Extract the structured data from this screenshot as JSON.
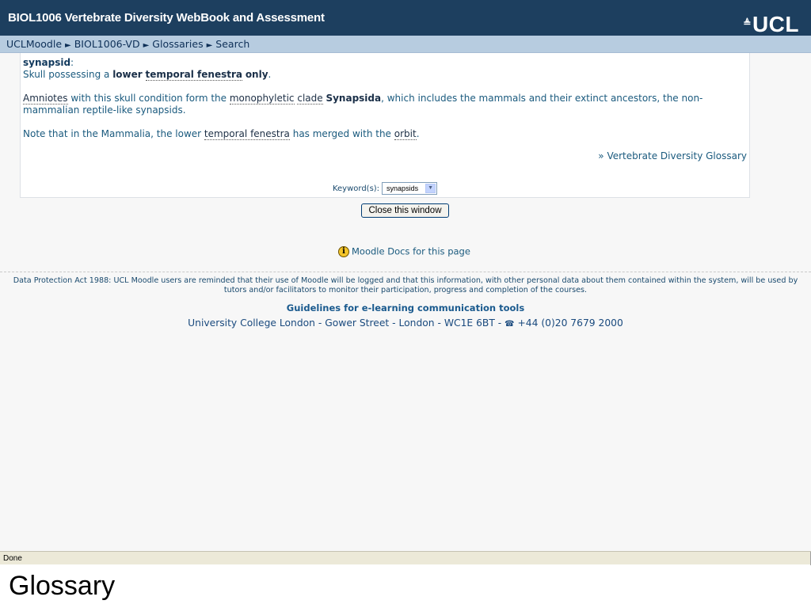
{
  "header": {
    "title": "BIOL1006 Vertebrate Diversity WebBook and Assessment",
    "logo_mark": "≜",
    "logo_text": "UCL"
  },
  "breadcrumb": {
    "items": [
      "UCLMoodle",
      "BIOL1006-VD",
      "Glossaries",
      "Search"
    ],
    "separator": "►"
  },
  "entry": {
    "concept": "synapsid",
    "colon": ":",
    "line1_prefix": "Skull possessing a ",
    "line1_bold1": "lower",
    "line1_link": "temporal fenestra",
    "line1_bold2": "only",
    "line1_end": ".",
    "p2_link1": "Amniotes",
    "p2_text1": " with this skull condition form the ",
    "p2_link2": "monophyletic",
    "p2_link3": "clade",
    "p2_bold": "Synapsida",
    "p2_text2": ", which includes the mammals and their extinct ancestors, the non-mammalian reptile-like synapsids.",
    "p3_text1": "Note that in the Mammalia, the lower ",
    "p3_link1": "temporal fenestra",
    "p3_text2": " has merged with the ",
    "p3_link2": "orbit",
    "p3_end": "."
  },
  "glossary_link": "» Vertebrate Diversity Glossary",
  "keyword": {
    "label": "Keyword(s):",
    "selected": "synapsids"
  },
  "close_button": "Close this window",
  "docs_link": "Moodle Docs for this page",
  "footer": {
    "data_protection": "Data Protection Act 1988: UCL Moodle users are reminded that their use of Moodle will be logged and that this information, with other personal data about them contained within the system, will be used by tutors and/or facilitators to monitor their participation, progress and completion of the courses.",
    "guidelines": "Guidelines for e-learning communication tools",
    "address_text": "University College London - Gower Street - London - WC1E 6BT - ",
    "phone_icon": "☎",
    "phone": " +44 (0)20 7679 2000"
  },
  "status": "Done",
  "caption": "Glossary",
  "colors": {
    "header_bg": "#1d3f5f",
    "navbar_bg": "#b7cce0",
    "link": "#1a5a7e"
  }
}
